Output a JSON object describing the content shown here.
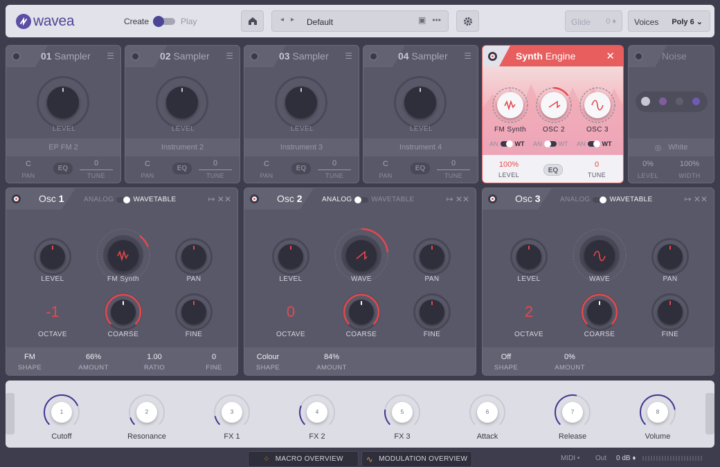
{
  "app": {
    "name": "wavea"
  },
  "header": {
    "create_label": "Create",
    "play_label": "Play",
    "preset_name": "Default",
    "glide_label": "Glide",
    "glide_value": "0 ♦",
    "voices_label": "Voices",
    "voices_value": "Poly 6 ⌄"
  },
  "samplers": [
    {
      "num": "01",
      "title": "Sampler",
      "instrument": "EP FM 2",
      "pan": "C",
      "tune": "0"
    },
    {
      "num": "02",
      "title": "Sampler",
      "instrument": "Instrument 2",
      "pan": "C",
      "tune": "0"
    },
    {
      "num": "03",
      "title": "Sampler",
      "instrument": "Instrument 3",
      "pan": "C",
      "tune": "0"
    },
    {
      "num": "04",
      "title": "Sampler",
      "instrument": "Instrument 4",
      "pan": "C",
      "tune": "0"
    }
  ],
  "labels": {
    "level": "LEVEL",
    "pan": "PAN",
    "tune": "TUNE",
    "eq": "EQ",
    "wave": "WAVE",
    "octave": "OCTAVE",
    "coarse": "COARSE",
    "fine": "FINE",
    "shape": "SHAPE",
    "amount": "AMOUNT",
    "ratio": "RATIO",
    "width": "WIDTH",
    "analog": "ANALOG",
    "wavetable": "WAVETABLE",
    "an": "AN",
    "wt": "WT"
  },
  "synth_engine": {
    "title_bold": "Synth",
    "title_rest": "Engine",
    "osc": [
      "FM Synth",
      "OSC 2",
      "OSC 3"
    ],
    "level": "100%",
    "tune": "0"
  },
  "noise": {
    "title": "Noise",
    "type": "White",
    "level": "0%",
    "width": "100%"
  },
  "oscillators": [
    {
      "name": "Osc",
      "num": "1",
      "wave_label": "FM Synth",
      "octave": "-1",
      "wavetable_on": true,
      "footer": [
        {
          "v": "FM",
          "l": "SHAPE"
        },
        {
          "v": "66%",
          "l": "AMOUNT"
        },
        {
          "v": "1.00",
          "l": "RATIO"
        },
        {
          "v": "0",
          "l": "FINE"
        }
      ]
    },
    {
      "name": "Osc",
      "num": "2",
      "wave_label": "WAVE",
      "octave": "0",
      "wavetable_on": false,
      "footer": [
        {
          "v": "Colour",
          "l": "SHAPE"
        },
        {
          "v": "84%",
          "l": "AMOUNT"
        }
      ]
    },
    {
      "name": "Osc",
      "num": "3",
      "wave_label": "WAVE",
      "octave": "2",
      "wavetable_on": true,
      "footer": [
        {
          "v": "Off",
          "l": "SHAPE"
        },
        {
          "v": "0%",
          "l": "AMOUNT"
        }
      ]
    }
  ],
  "macros": [
    {
      "n": "1",
      "label": "Cutoff",
      "value": 0.75
    },
    {
      "n": "2",
      "label": "Resonance",
      "value": 0.1
    },
    {
      "n": "3",
      "label": "FX 1",
      "value": 0.12
    },
    {
      "n": "4",
      "label": "FX 2",
      "value": 0.25
    },
    {
      "n": "5",
      "label": "FX 3",
      "value": 0.2
    },
    {
      "n": "6",
      "label": "Attack",
      "value": 0.0
    },
    {
      "n": "7",
      "label": "Release",
      "value": 0.55
    },
    {
      "n": "8",
      "label": "Volume",
      "value": 0.8
    }
  ],
  "footer": {
    "macro_overview": "MACRO OVERVIEW",
    "modulation_overview": "MODULATION OVERVIEW",
    "midi": "MIDI •",
    "out": "Out",
    "out_value": "0 dB ♦"
  },
  "colors": {
    "accent_red": "#e5484d",
    "brand_purple": "#4d4596"
  }
}
